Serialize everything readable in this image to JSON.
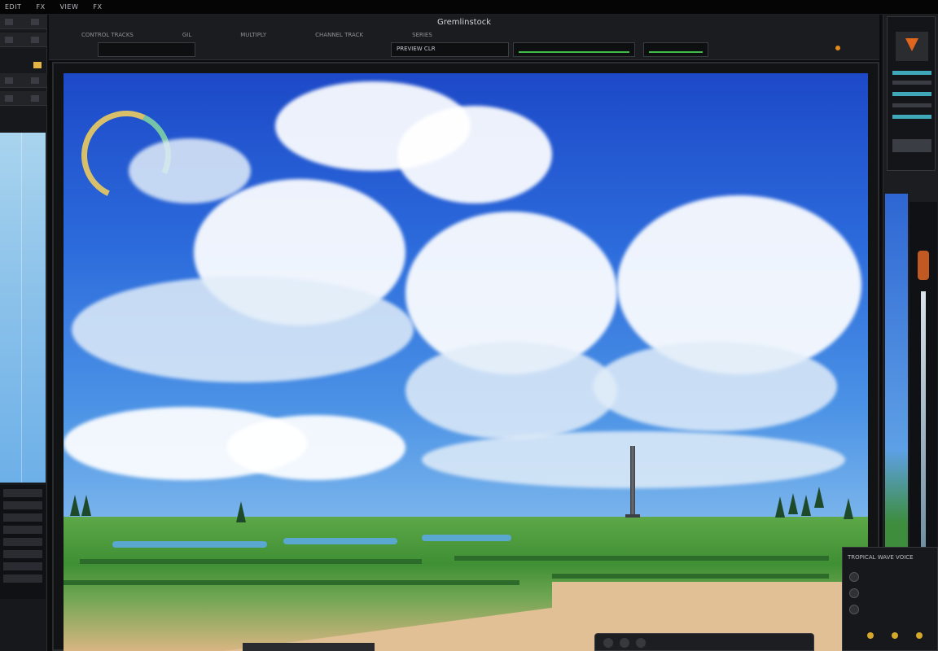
{
  "menubar": {
    "items": [
      "EDIT",
      "FX",
      "VIEW",
      "FX"
    ]
  },
  "viewer": {
    "title": "Gremlinstock",
    "row_labels": [
      "CONTROL TRACKS",
      "GIL",
      "MULTIPLY",
      "CHANNEL TRACK",
      "SERIES"
    ]
  },
  "transport_boxes": [
    {
      "label": "PREVIEW CLR",
      "has_meter": false
    },
    {
      "label": "",
      "has_meter": true
    },
    {
      "label": "",
      "has_meter": true
    }
  ],
  "right_panel": {
    "bottom_label": "TROPICAL WAVE VOICE"
  },
  "colors": {
    "accent_orange": "#e0661d",
    "meter_green": "#3fbf4a",
    "accent_yellow": "#e2b640"
  }
}
